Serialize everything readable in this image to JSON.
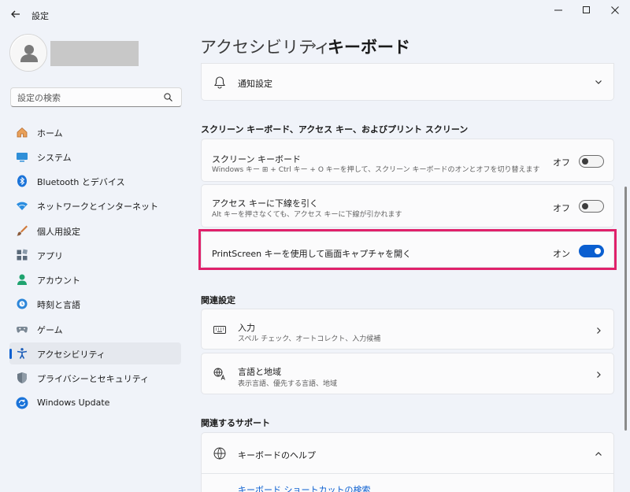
{
  "window": {
    "app_title": "設定"
  },
  "sidebar": {
    "search_placeholder": "設定の検索",
    "items": [
      {
        "label": "ホーム"
      },
      {
        "label": "システム"
      },
      {
        "label": "Bluetooth とデバイス"
      },
      {
        "label": "ネットワークとインターネット"
      },
      {
        "label": "個人用設定"
      },
      {
        "label": "アプリ"
      },
      {
        "label": "アカウント"
      },
      {
        "label": "時刻と言語"
      },
      {
        "label": "ゲーム"
      },
      {
        "label": "アクセシビリティ",
        "selected": true
      },
      {
        "label": "プライバシーとセキュリティ"
      },
      {
        "label": "Windows Update"
      }
    ]
  },
  "breadcrumb": {
    "parent": "アクセシビリティ",
    "separator": "›",
    "current": "キーボード"
  },
  "main": {
    "notification_row": {
      "title": "通知設定"
    },
    "section1_title": "スクリーン キーボード、アクセス キー、およびプリント スクリーン",
    "onscreen_keyboard": {
      "title": "スクリーン キーボード",
      "desc": "Windows キー ⊞ + Ctrl キー + O キーを押して、スクリーン キーボードのオンとオフを切り替えます",
      "state_label": "オフ",
      "on": false
    },
    "access_keys": {
      "title": "アクセス キーに下線を引く",
      "desc": "Alt キーを押さなくても、アクセス キーに下線が引かれます",
      "state_label": "オフ",
      "on": false
    },
    "printscreen": {
      "title": "PrintScreen キーを使用して画面キャプチャを開く",
      "state_label": "オン",
      "on": true
    },
    "section2_title": "関連設定",
    "input_row": {
      "title": "入力",
      "desc": "スペル チェック、オートコレクト、入力候補"
    },
    "language_row": {
      "title": "言語と地域",
      "desc": "表示言語、優先する言語、地域"
    },
    "section3_title": "関連するサポート",
    "help_row": {
      "title": "キーボードのヘルプ"
    },
    "help_link": "キーボード ショートカットの検索"
  },
  "colors": {
    "accent": "#0b5fd0",
    "highlight_border": "#e0216a",
    "background": "#f0f3f9"
  }
}
